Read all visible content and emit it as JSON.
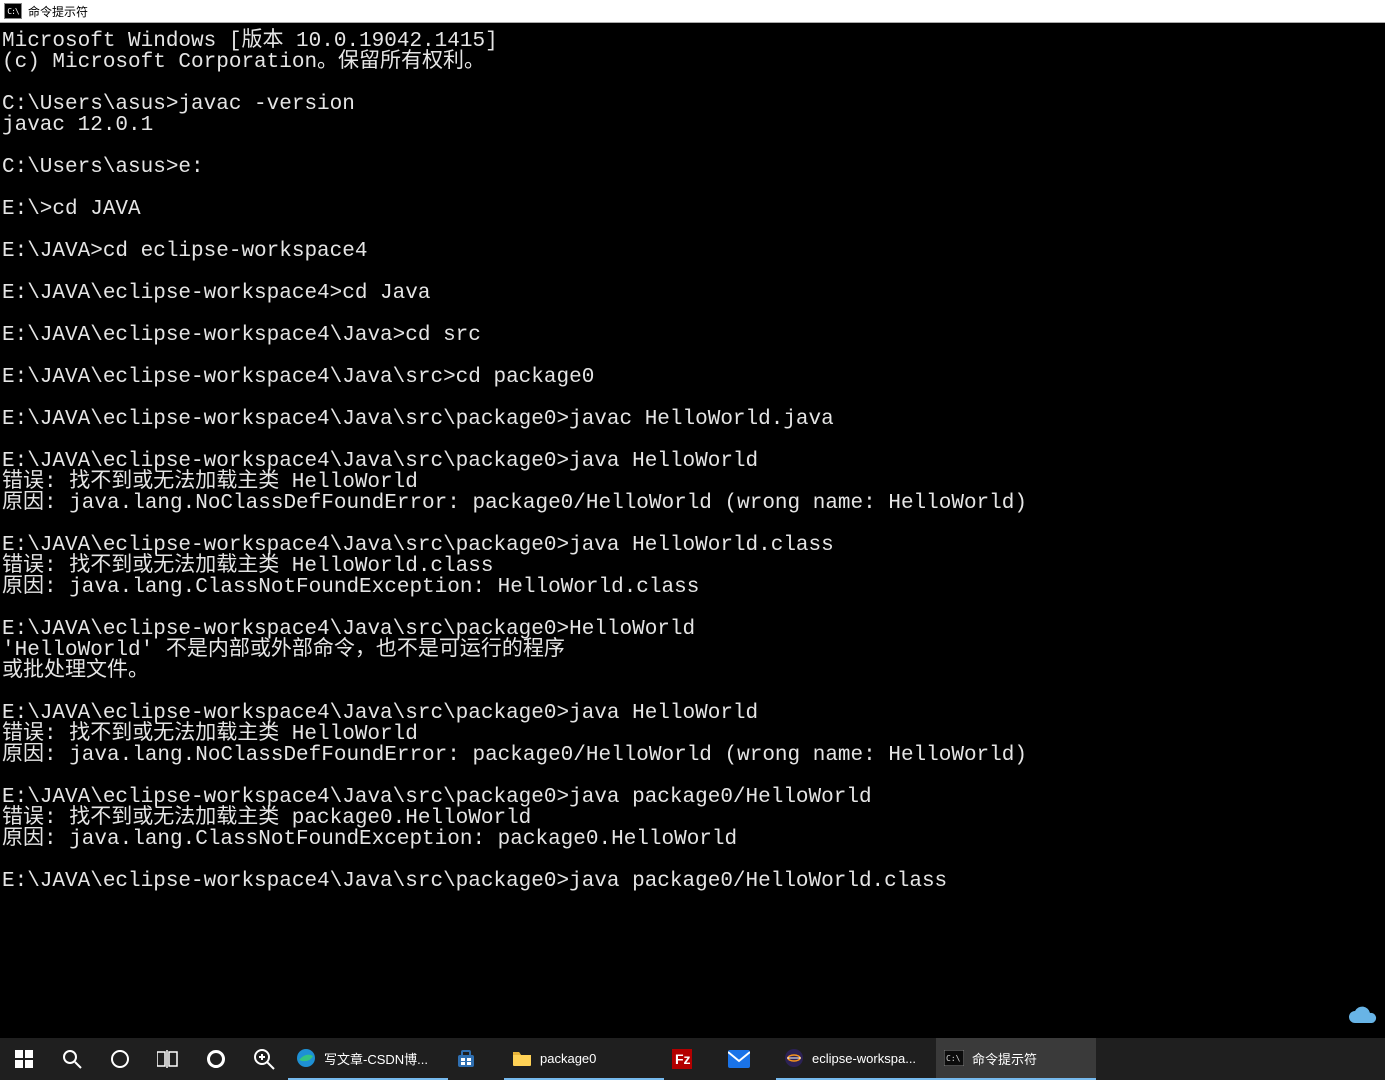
{
  "window": {
    "title": "命令提示符"
  },
  "terminal": {
    "lines": [
      "Microsoft Windows [版本 10.0.19042.1415]",
      "(c) Microsoft Corporation。保留所有权利。",
      "",
      "C:\\Users\\asus>javac -version",
      "javac 12.0.1",
      "",
      "C:\\Users\\asus>e:",
      "",
      "E:\\>cd JAVA",
      "",
      "E:\\JAVA>cd eclipse-workspace4",
      "",
      "E:\\JAVA\\eclipse-workspace4>cd Java",
      "",
      "E:\\JAVA\\eclipse-workspace4\\Java>cd src",
      "",
      "E:\\JAVA\\eclipse-workspace4\\Java\\src>cd package0",
      "",
      "E:\\JAVA\\eclipse-workspace4\\Java\\src\\package0>javac HelloWorld.java",
      "",
      "E:\\JAVA\\eclipse-workspace4\\Java\\src\\package0>java HelloWorld",
      "错误: 找不到或无法加载主类 HelloWorld",
      "原因: java.lang.NoClassDefFoundError: package0/HelloWorld (wrong name: HelloWorld)",
      "",
      "E:\\JAVA\\eclipse-workspace4\\Java\\src\\package0>java HelloWorld.class",
      "错误: 找不到或无法加载主类 HelloWorld.class",
      "原因: java.lang.ClassNotFoundException: HelloWorld.class",
      "",
      "E:\\JAVA\\eclipse-workspace4\\Java\\src\\package0>HelloWorld",
      "'HelloWorld' 不是内部或外部命令，也不是可运行的程序",
      "或批处理文件。",
      "",
      "E:\\JAVA\\eclipse-workspace4\\Java\\src\\package0>java HelloWorld",
      "错误: 找不到或无法加载主类 HelloWorld",
      "原因: java.lang.NoClassDefFoundError: package0/HelloWorld (wrong name: HelloWorld)",
      "",
      "E:\\JAVA\\eclipse-workspace4\\Java\\src\\package0>java package0/HelloWorld",
      "错误: 找不到或无法加载主类 package0.HelloWorld",
      "原因: java.lang.ClassNotFoundException: package0.HelloWorld",
      "",
      "E:\\JAVA\\eclipse-workspace4\\Java\\src\\package0>java package0/HelloWorld.class"
    ]
  },
  "taskbar": {
    "apps": {
      "edge": "写文章-CSDN博...",
      "explorer": "package0",
      "eclipse": "eclipse-workspa...",
      "cmd": "命令提示符"
    }
  }
}
